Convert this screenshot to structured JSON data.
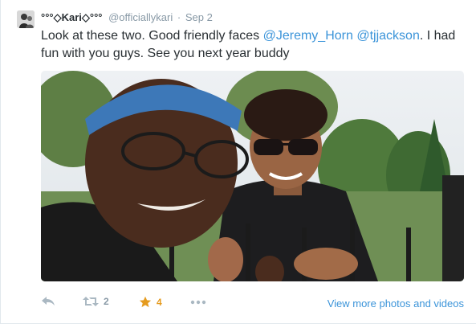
{
  "tweet": {
    "display_name": "°°°◇Kari◇°°°",
    "handle": "@officiallykari",
    "separator": "·",
    "date": "Sep 2",
    "text_before": "Look at these two. Good friendly faces ",
    "mention1": "@Jeremy_Horn",
    "text_between": " ",
    "mention2": "@tjjackson",
    "text_after": ". I had fun with you guys. See you next year buddy"
  },
  "actions": {
    "retweet_count": "2",
    "favorite_count": "4",
    "view_more_label": "View more photos and videos"
  },
  "colors": {
    "link": "#3b94d9",
    "muted": "#8899a6",
    "favorite": "#e59b1f"
  },
  "icons": {
    "reply": "reply-icon",
    "retweet": "retweet-icon",
    "favorite": "star-icon",
    "more": "more-icon"
  }
}
